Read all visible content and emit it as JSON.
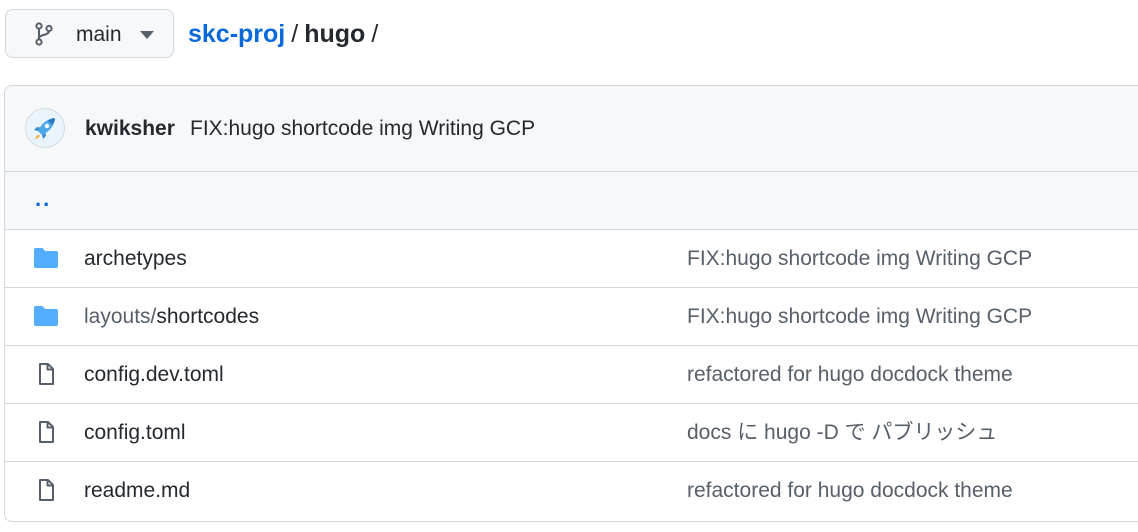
{
  "branch": {
    "label": "main",
    "icon": "git-branch-icon"
  },
  "breadcrumb": {
    "repo": "skc-proj",
    "separator": "/",
    "current": "hugo",
    "trailing": "/"
  },
  "latest_commit": {
    "author": "kwiksher",
    "message": "FIX:hugo shortcode img Writing GCP",
    "avatar_icon": "rocket-avatar-icon"
  },
  "parent_dir": {
    "label": ".."
  },
  "files": [
    {
      "type": "dir",
      "icon": "folder-icon",
      "prefix": "",
      "name": "archetypes",
      "message": "FIX:hugo shortcode img Writing GCP"
    },
    {
      "type": "dir",
      "icon": "folder-icon",
      "prefix": "layouts/",
      "name": "shortcodes",
      "message": "FIX:hugo shortcode img Writing GCP"
    },
    {
      "type": "file",
      "icon": "file-icon",
      "prefix": "",
      "name": "config.dev.toml",
      "message": "refactored for hugo docdock theme"
    },
    {
      "type": "file",
      "icon": "file-icon",
      "prefix": "",
      "name": "config.toml",
      "message": "docs に hugo -D で パブリッシュ"
    },
    {
      "type": "file",
      "icon": "file-icon",
      "prefix": "",
      "name": "readme.md",
      "message": "refactored for hugo docdock theme"
    }
  ],
  "colors": {
    "link": "#0969da",
    "folder": "#54aeff",
    "border": "#d0d7de",
    "muted_bg": "#f6f8fa"
  }
}
